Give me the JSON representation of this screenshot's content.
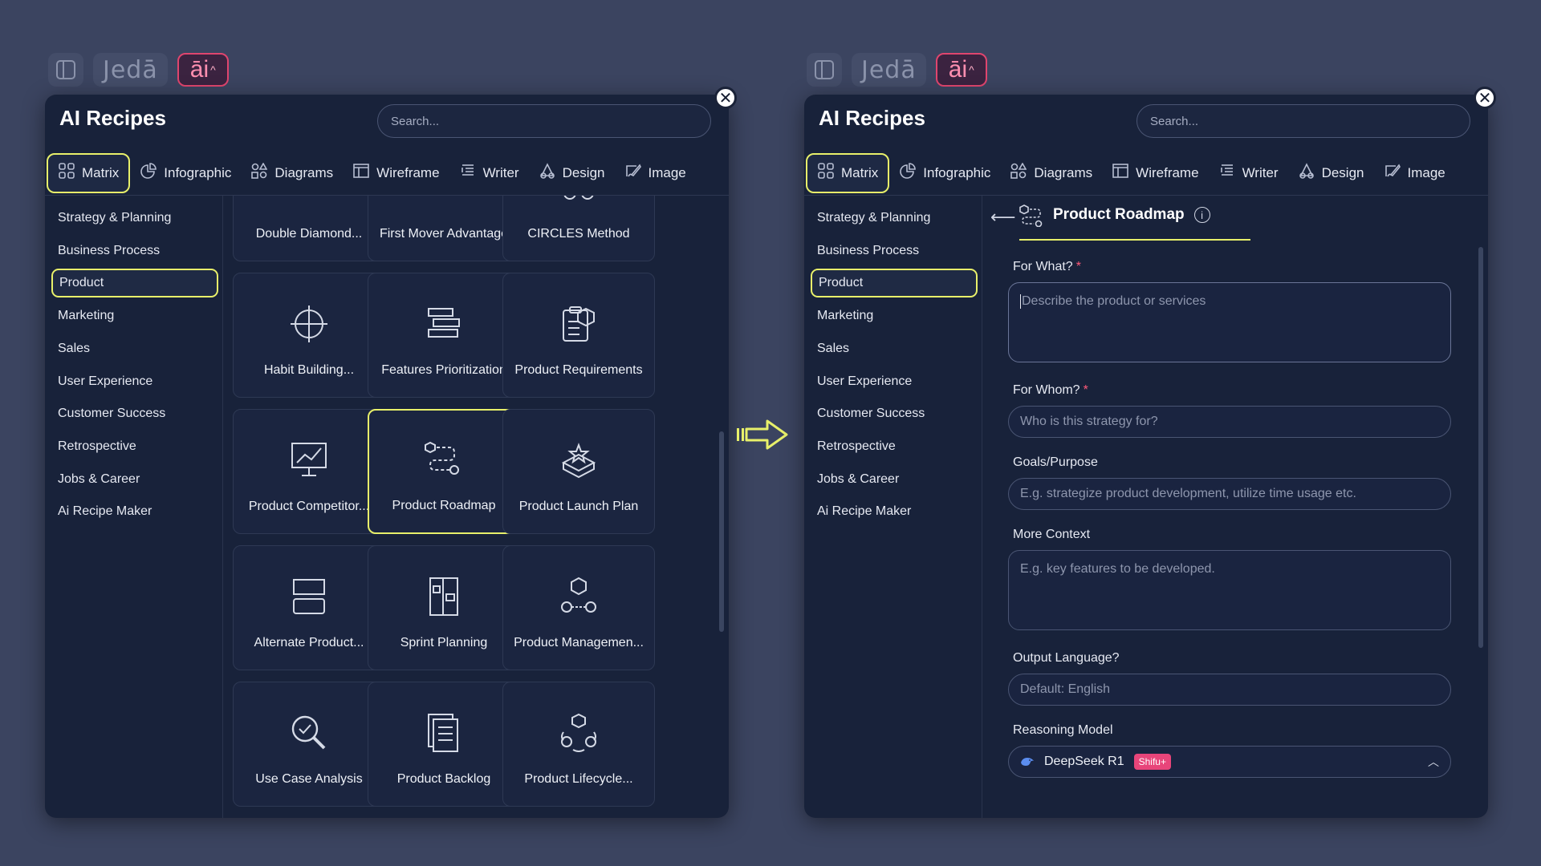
{
  "toolbar": {
    "jeda": "Jedā",
    "ai": "āi",
    "ai_chev": "^"
  },
  "panel": {
    "title": "AI Recipes",
    "search_placeholder": "Search...",
    "close": "✕"
  },
  "tabs": [
    {
      "label": "Matrix",
      "icon": "grid-icon"
    },
    {
      "label": "Infographic",
      "icon": "pie-icon"
    },
    {
      "label": "Diagrams",
      "icon": "shapes-icon"
    },
    {
      "label": "Wireframe",
      "icon": "wireframe-icon"
    },
    {
      "label": "Writer",
      "icon": "writer-icon"
    },
    {
      "label": "Design",
      "icon": "design-icon"
    },
    {
      "label": "Image",
      "icon": "image-icon"
    }
  ],
  "sidebar": [
    "Strategy & Planning",
    "Business Process",
    "Product",
    "Marketing",
    "Sales",
    "User Experience",
    "Customer Success",
    "Retrospective",
    "Jobs & Career",
    "Ai Recipe Maker"
  ],
  "sidebar_active": "Product",
  "cards": [
    "Double Diamond...",
    "First Mover Advantage",
    "CIRCLES Method",
    "Habit Building...",
    "Features Prioritization",
    "Product Requirements",
    "Product Competitor...",
    "Product Roadmap",
    "Product Launch Plan",
    "Alternate Product...",
    "Sprint Planning",
    "Product Managemen...",
    "Use Case Analysis",
    "Product Backlog",
    "Product Lifecycle..."
  ],
  "card_active": "Product Roadmap",
  "form": {
    "back": "⟵",
    "title": "Product Roadmap",
    "info": "i",
    "required_mark": "*",
    "fields": {
      "for_what": {
        "label": "For What?",
        "placeholder": "Describe the product or services"
      },
      "for_whom": {
        "label": "For Whom?",
        "placeholder": "Who is this strategy for?"
      },
      "goals": {
        "label": "Goals/Purpose",
        "placeholder": "E.g. strategize product development, utilize time usage etc."
      },
      "context": {
        "label": "More Context",
        "placeholder": "E.g. key features to be developed."
      },
      "language": {
        "label": "Output Language?",
        "placeholder": "Default: English"
      },
      "model": {
        "label": "Reasoning Model",
        "value": "DeepSeek R1",
        "badge": "Shifu+"
      }
    }
  },
  "colors": {
    "accent": "#e8f06a",
    "background": "#3b4460",
    "panel": "#18223a",
    "badge": "#e8457a"
  }
}
